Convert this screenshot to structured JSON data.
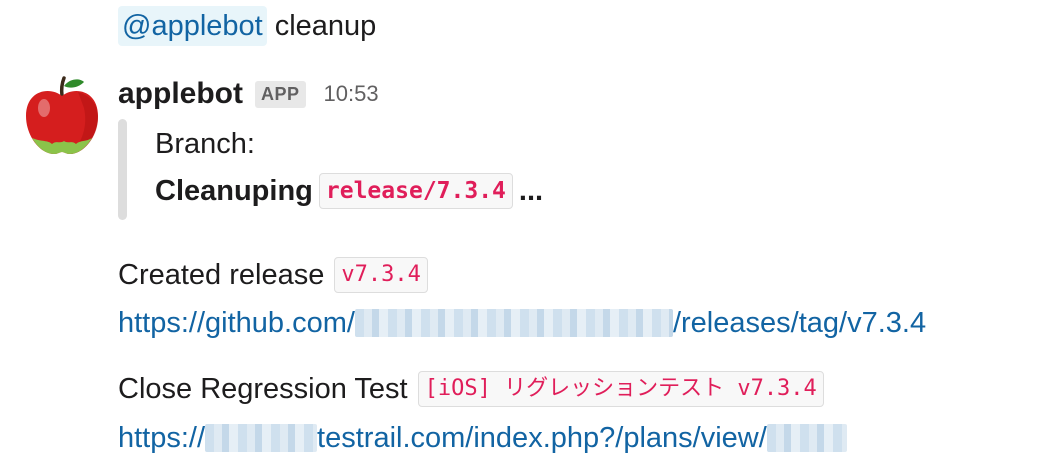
{
  "previous_message": {
    "mention": "@applebot",
    "text": "cleanup"
  },
  "message": {
    "avatar_icon": "apple-icon",
    "sender": "applebot",
    "badge": "APP",
    "time": "10:53",
    "attachment": {
      "title": "Branch:",
      "body_prefix": "Cleanuping",
      "branch_code": "release/7.3.4",
      "body_suffix": "..."
    },
    "release_line": {
      "text": "Created release",
      "code": "v7.3.4"
    },
    "release_link": {
      "prefix": "https://github.com/",
      "suffix": "/releases/tag/v7.3.4"
    },
    "regression_line": {
      "text": "Close Regression Test",
      "code": "[iOS] リグレッションテスト v7.3.4"
    },
    "testrail_link": {
      "prefix": "https://",
      "middle": "testrail.com/index.php?/plans/view/"
    }
  },
  "colors": {
    "link": "#1264a3",
    "code_text": "#e01e5a",
    "mention_bg": "#e8f5fa",
    "attachment_bar": "#dddddd"
  }
}
